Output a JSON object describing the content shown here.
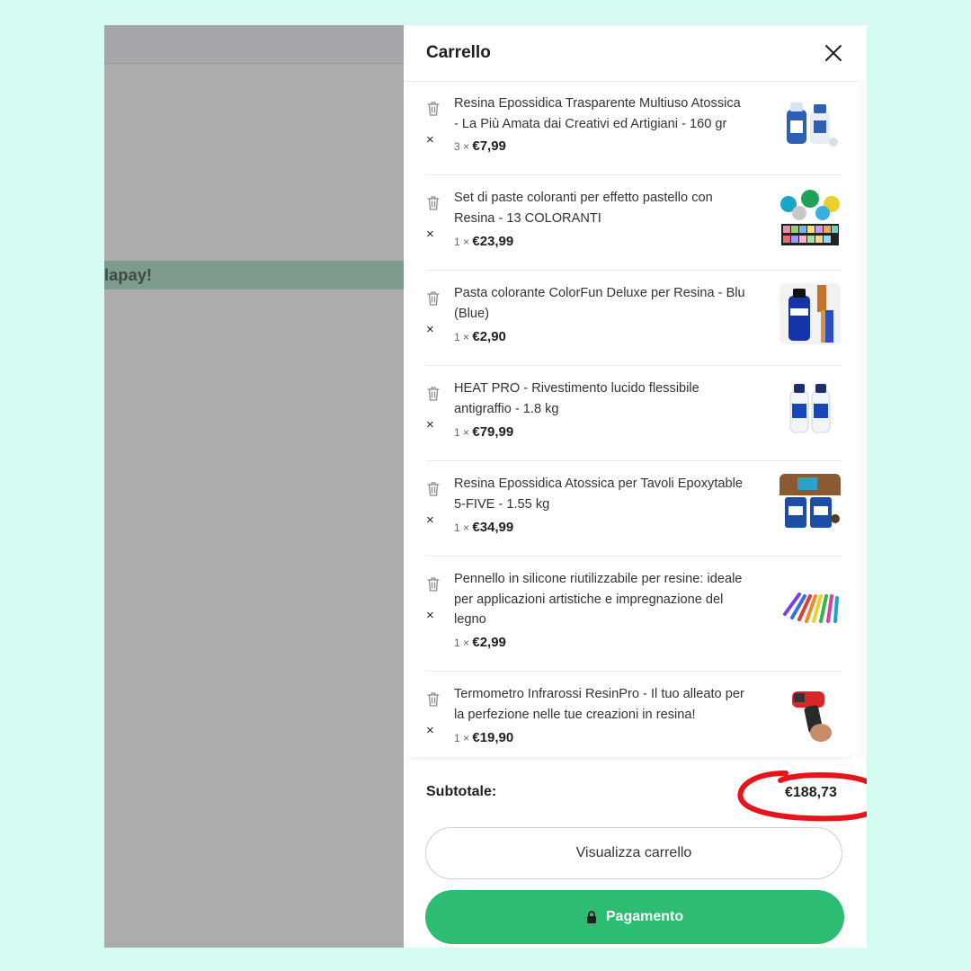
{
  "background": {
    "overlay_banner_text": "lapay!"
  },
  "drawer": {
    "title": "Carrello",
    "items": [
      {
        "title": "Resina Epossidica Trasparente Multiuso Atossica - La Più Amata dai Creativi ed Artigiani - 160 gr",
        "qty": "3 ×",
        "price": "€7,99"
      },
      {
        "title": "Set di paste coloranti per effetto pastello con Resina - 13 COLORANTI",
        "qty": "1 ×",
        "price": "€23,99"
      },
      {
        "title": "Pasta colorante ColorFun Deluxe per Resina - Blu (Blue)",
        "qty": "1 ×",
        "price": "€2,90"
      },
      {
        "title": "HEAT PRO - Rivestimento lucido flessibile antigraffio - 1.8 kg",
        "qty": "1 ×",
        "price": "€79,99"
      },
      {
        "title": "Resina Epossidica Atossica per Tavoli Epoxytable 5-FIVE - 1.55 kg",
        "qty": "1 ×",
        "price": "€34,99"
      },
      {
        "title": "Pennello in silicone riutilizzabile per resine: ideale per applicazioni artistiche e impregnazione del legno",
        "qty": "1 ×",
        "price": "€2,99"
      },
      {
        "title": "Termometro Infrarossi ResinPro - Il tuo alleato per la perfezione nelle tue creazioni in resina!",
        "qty": "1 ×",
        "price": "€19,90"
      }
    ],
    "remove_symbol": "×",
    "subtotal_label": "Subtotale:",
    "subtotal_value": "€188,73",
    "view_cart_label": "Visualizza carrello",
    "checkout_label": "Pagamento"
  },
  "colors": {
    "page_bg": "#d6fbf2",
    "checkout_green": "#2dbd72",
    "annotation_red": "#e8141b"
  }
}
